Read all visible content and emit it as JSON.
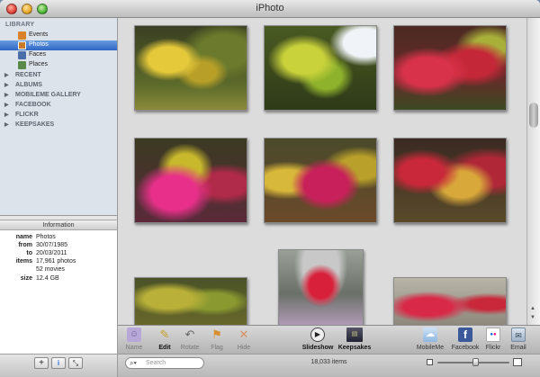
{
  "window": {
    "title": "iPhoto"
  },
  "sidebar": {
    "library_header": "LIBRARY",
    "library_items": [
      {
        "label": "Events",
        "icon": "events-icon",
        "color": "#d9822b"
      },
      {
        "label": "Photos",
        "icon": "photos-icon",
        "color": "#c77a2a",
        "selected": true
      },
      {
        "label": "Faces",
        "icon": "faces-icon",
        "color": "#4a6ea8"
      },
      {
        "label": "Places",
        "icon": "places-icon",
        "color": "#5a8a4a"
      }
    ],
    "groups": [
      "RECENT",
      "ALBUMS",
      "MOBILEME GALLERY",
      "FACEBOOK",
      "FLICKR",
      "KEEPSAKES"
    ]
  },
  "info": {
    "header": "Information",
    "rows": [
      {
        "key": "name",
        "value": "Photos"
      },
      {
        "key": "from",
        "value": "30/07/1985"
      },
      {
        "key": "to",
        "value": "20/03/2011"
      },
      {
        "key": "items",
        "value": "17,961 photos"
      },
      {
        "key": "",
        "value": "52 movies"
      },
      {
        "key": "size",
        "value": "12.4 GB"
      }
    ]
  },
  "sidebar_footer": {
    "add_label": "+",
    "info_label": "i",
    "fullscreen_label": "⤡"
  },
  "toolbar": {
    "name": "Name",
    "edit": "Edit",
    "rotate": "Rotate",
    "flag": "Flag",
    "hide": "Hide",
    "slideshow": "Slideshow",
    "keepsakes": "Keepsakes",
    "mobileme": "MobileMe",
    "facebook": "Facebook",
    "flickr": "Flickr",
    "email": "Email"
  },
  "statusbar": {
    "search_placeholder": "Search",
    "item_count": "18,033 items"
  },
  "zoom": {
    "level": 0.5
  },
  "colors": {
    "selection": "#2f66c4",
    "sidebar_bg": "#dde3ea"
  }
}
